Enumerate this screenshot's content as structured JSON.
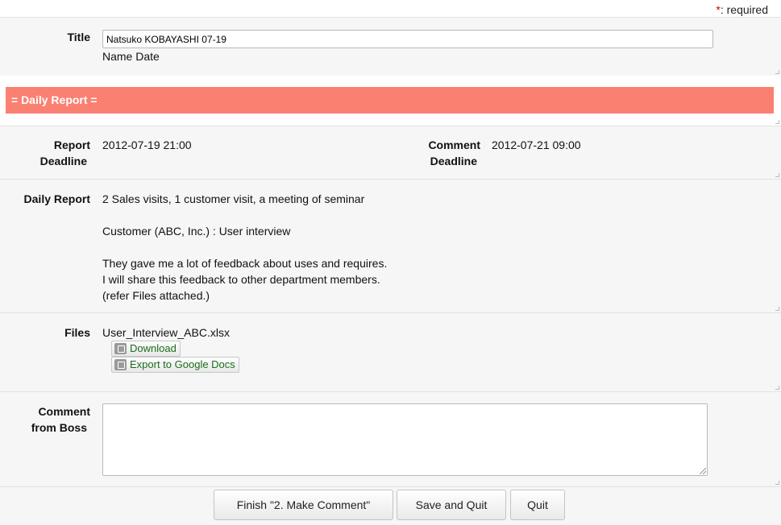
{
  "required_note": {
    "star": "*",
    "text": ": required"
  },
  "title_field": {
    "label": "Title",
    "value": "Natsuko KOBAYASHI 07-19",
    "hint": "Name Date"
  },
  "section": {
    "heading": "= Daily Report ="
  },
  "deadlines": {
    "report_label_1": "Report",
    "report_label_2": "Deadline",
    "report_value": "2012-07-19 21:00",
    "comment_label_1": "Comment",
    "comment_label_2": "Deadline",
    "comment_value": "2012-07-21 09:00"
  },
  "daily_report": {
    "label": "Daily Report",
    "line1": "2 Sales visits, 1 customer visit, a meeting of seminar",
    "line2": "Customer (ABC, Inc.) : User interview",
    "line3": "They gave me a lot of feedback about uses and requires.",
    "line4": "I will share this feedback to other department members.",
    "line5": "(refer Files attached.)"
  },
  "files": {
    "label": "Files",
    "file_name": "User_Interview_ABC.xlsx",
    "download_label": "Download",
    "export_label": "Export to Google Docs"
  },
  "comment": {
    "label_1": "Comment",
    "label_2": "from Boss",
    "value": ""
  },
  "actions": {
    "finish_label": "Finish \"2. Make Comment\"",
    "save_label": "Save and Quit",
    "quit_label": "Quit"
  },
  "colors": {
    "section_band": "#fa8072",
    "required_star": "#cc0000",
    "link_green": "#1a6e1a"
  }
}
